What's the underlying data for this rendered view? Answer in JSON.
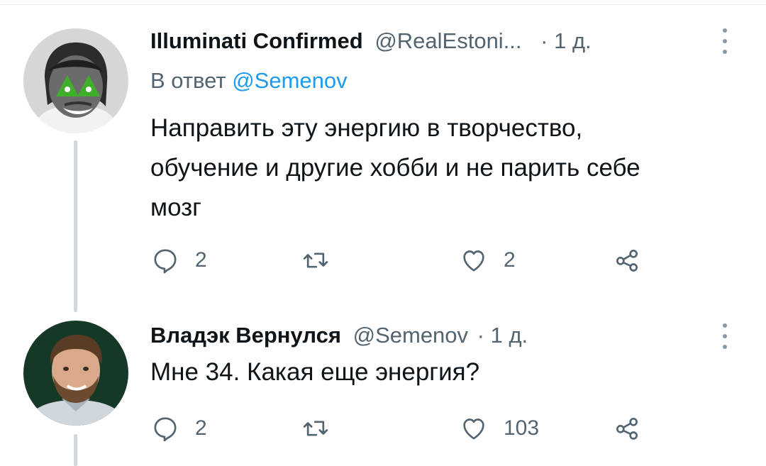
{
  "tweets": [
    {
      "author_name": "Illuminati Confirmed",
      "author_handle": "@RealEstoni...",
      "time": "· 1 д.",
      "reply_prefix": "В ответ",
      "reply_to": "@Semenov",
      "text_lines": [
        "Направить эту энергию в творчество,",
        "обучение и другие хобби и не парить себе",
        "мозг"
      ],
      "replies": "2",
      "retweets": "",
      "likes": "2"
    },
    {
      "author_name": "Владэк Вернулся",
      "author_handle": "@Semenov",
      "time": "· 1 д.",
      "text_lines": [
        "Мне 34. Какая еще энергия?"
      ],
      "replies": "2",
      "retweets": "",
      "likes": "103"
    }
  ],
  "colors": {
    "text": "#0f1419",
    "secondary": "#536471",
    "link": "#1d9bf0",
    "thread_line": "#cfd9de"
  },
  "icons": [
    "reply-icon",
    "retweet-icon",
    "like-icon",
    "share-icon",
    "more-icon"
  ]
}
